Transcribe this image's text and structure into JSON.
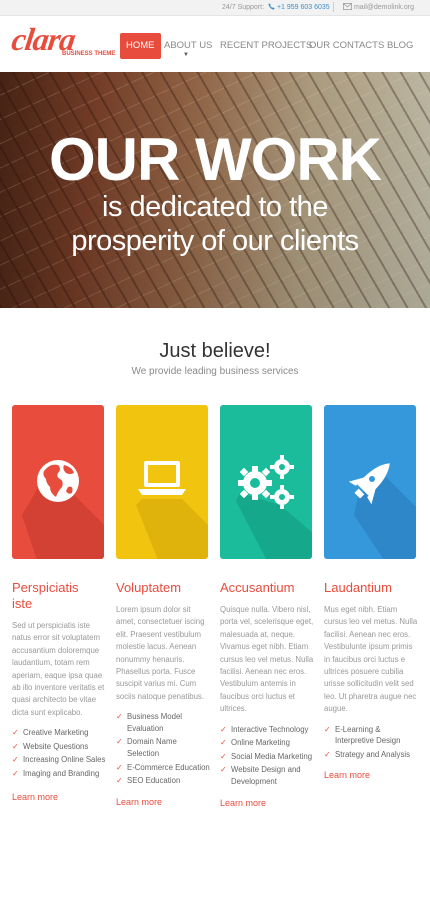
{
  "topbar": {
    "support_label": "24/7 Support:",
    "phone_icon": "phone-icon",
    "phone": "+1 959 603 6035",
    "mail_icon": "envelope-icon",
    "email": "mail@demolink.org"
  },
  "brand": {
    "name": "clara",
    "tagline": "BUSINESS THEME",
    "color": "#e84c3d"
  },
  "nav": {
    "items": [
      {
        "label": "HOME",
        "active": true
      },
      {
        "label": "ABOUT US",
        "active": false
      },
      {
        "label": "RECENT PROJECTS",
        "active": false
      },
      {
        "label": "OUR CONTACTS",
        "active": false
      },
      {
        "label": "BLOG",
        "active": false
      }
    ]
  },
  "hero": {
    "title": "OUR WORK",
    "subtitle_line1": "is dedicated to the",
    "subtitle_line2": "prosperity of our clients"
  },
  "intro": {
    "heading": "Just believe!",
    "subheading": "We provide leading business services"
  },
  "services": [
    {
      "color": "#e84c3d",
      "icon": "globe-icon",
      "title_line1": "Perspiciatis",
      "title_line2": "iste",
      "body": "Sed ut perspiciatis iste natus error sit voluptatem accusantium doloremque laudantium, totam rem aperiam, eaque ipsa quae ab illo inventore veritatis et quasi architecto be vitae dicta sunt explicabo.",
      "bullets": [
        "Creative Marketing",
        "Website Questions",
        "Increasing Online Sales",
        "Imaging and Branding"
      ],
      "learn_more": "Learn more"
    },
    {
      "color": "#f1c40f",
      "icon": "laptop-icon",
      "title_line1": "Voluptatem",
      "title_line2": "",
      "body": "Lorem ipsum dolor sit amet, consectetuer iscing elit. Praesent vestibulum molestie lacus. Aenean nonummy henauris. Phasellus porta. Fusce suscipit varius mi. Cum sociis natoque penatibus.",
      "bullets": [
        "Business Model Evaluation",
        "Domain Name Selection",
        "E-Commerce Education",
        "SEO Education"
      ],
      "learn_more": "Learn more"
    },
    {
      "color": "#1abc9c",
      "icon": "gears-icon",
      "title_line1": "Accusantium",
      "title_line2": "",
      "body": "Quisque nulla. Vibero nisl, porta vel, scelerisque eget, malesuada at, neque. Vivamus eget nibh. Etiam cursus leo vel metus. Nulla facilisi. Aenean nec eros. Vestibulum antemis in faucibus orci luctus et ultrices.",
      "bullets": [
        "Interactive Technology",
        "Online Marketing",
        "Social Media Marketing",
        "Website Design and Development"
      ],
      "learn_more": "Learn more"
    },
    {
      "color": "#3498db",
      "icon": "rocket-icon",
      "title_line1": "Laudantium",
      "title_line2": "",
      "body": "Mus eget nibh. Etiam cursus leo vel metus. Nulla facilisi. Aenean nec eros. Vestibulunte ipsum primis in faucibus orci luctus e ultrices posuere cubilia urisse sollicitudin velit sed leo. Ut pharetra augue nec augue.",
      "bullets": [
        "E-Learning & Interpretive Design",
        "Strategy and Analysis"
      ],
      "learn_more": "Learn more"
    }
  ]
}
